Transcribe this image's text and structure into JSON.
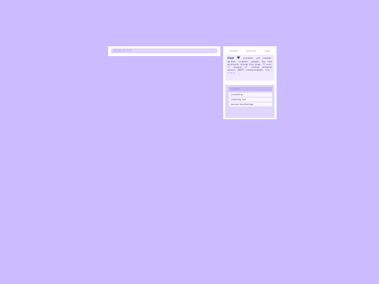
{
  "search": {
    "label": "SEARCH TAT"
  },
  "nav": {
    "items": [
      "HOME",
      "ARCHIV",
      "ASK"
    ]
  },
  "bio": {
    "name": "rae",
    "heart": "♥",
    "text": "creator. art maker. writer. crafter. vegan for the animals. triple fire sign. ♈ sun. ♌ moon. ♐ rising. atheist witch. INFP. cheerleader. CH",
    "more": "( more... )"
  },
  "links": {
    "title": "LINKS",
    "items": [
      "currently",
      "reading list",
      "joined fanlistings"
    ]
  }
}
